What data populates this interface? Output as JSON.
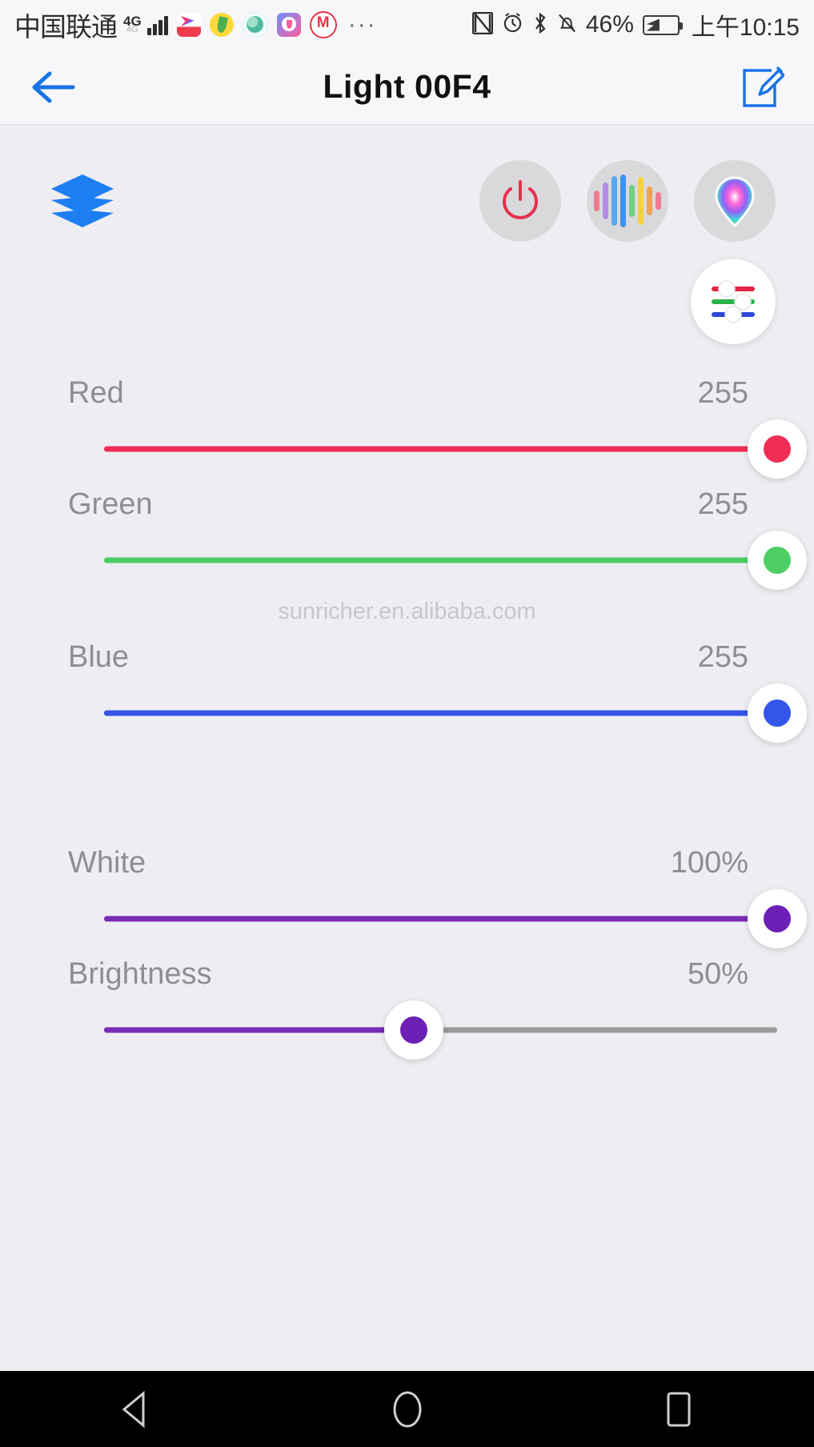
{
  "status_bar": {
    "carrier": "中国联通",
    "network_type": "4G",
    "network_sub": "4G",
    "app_icons": [
      "kuaishou-icon",
      "qq-music-icon",
      "browser-icon",
      "music-app-icon",
      "meituan-icon"
    ],
    "overflow": "···",
    "nfc": "N",
    "alarm": "alarm-icon",
    "bluetooth": "bluetooth-icon",
    "silent": "bell-off-icon",
    "battery_percent": "46%",
    "time": "上午10:15"
  },
  "app_bar": {
    "back": "back-arrow-icon",
    "title": "Light 00F4",
    "edit": "edit-icon"
  },
  "main": {
    "group_icon": "layers-icon",
    "mode_buttons": [
      {
        "name": "power-button",
        "icon": "power-icon",
        "color": "#e8304f"
      },
      {
        "name": "music-mode-button",
        "icon": "equalizer-icon"
      },
      {
        "name": "color-picker-button",
        "icon": "color-drop-icon"
      }
    ],
    "eq_bar_colors": [
      "#f2798f",
      "#b48ce8",
      "#5aa7f0",
      "#3f93ef",
      "#6fd080",
      "#f6d23a",
      "#f0a24e",
      "#f2798f"
    ],
    "rgb_slider_toggle": {
      "name": "rgb-sliders-toggle",
      "icon": "sliders-icon"
    },
    "watermark": "sunricher.en.alibaba.com",
    "sliders": [
      {
        "label": "Red",
        "value": "255",
        "percent": 100,
        "color": "#ef2d55",
        "thumb_color": "#ef2d55"
      },
      {
        "label": "Green",
        "value": "255",
        "percent": 100,
        "color": "#4cce63",
        "thumb_color": "#4cce63"
      },
      {
        "label": "Blue",
        "value": "255",
        "percent": 100,
        "color": "#3355e8",
        "thumb_color": "#3355e8"
      },
      {
        "label": "White",
        "value": "100%",
        "percent": 100,
        "color": "#7a2bb5",
        "thumb_color": "#6d1fb5"
      },
      {
        "label": "Brightness",
        "value": "50%",
        "percent": 46,
        "color": "#7a2bb5",
        "thumb_color": "#6d1fb5"
      }
    ]
  },
  "nav_bar": {
    "items": [
      {
        "name": "nav-back",
        "icon": "triangle-back-icon"
      },
      {
        "name": "nav-home",
        "icon": "circle-home-icon"
      },
      {
        "name": "nav-recents",
        "icon": "square-recents-icon"
      }
    ]
  }
}
